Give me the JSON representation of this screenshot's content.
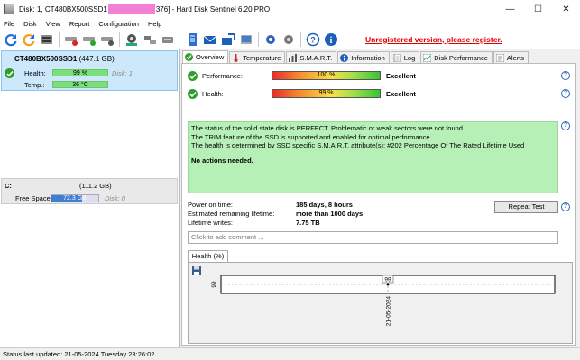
{
  "window": {
    "title_prefix": "Disk: 1, CT480BX500SSD1",
    "title_suffix": "376]  -  Hard Disk Sentinel 6.20 PRO",
    "minimize": "—",
    "maximize": "☐",
    "close": "✕"
  },
  "menu": {
    "file": "File",
    "disk": "Disk",
    "view": "View",
    "report": "Report",
    "configuration": "Configuration",
    "help": "Help"
  },
  "toolbar": {
    "unregistered": "Unregistered version, please register."
  },
  "disk": {
    "name": "CT480BX500SSD1",
    "size": "(447.1 GB)",
    "health_label": "Health:",
    "health_value": "99 %",
    "health_fraction": 0.99,
    "temp_label": "Temp.:",
    "temp_value": "36 °C",
    "disk_index": "Disk: 1"
  },
  "volume": {
    "letter": "C:",
    "size": "(111.2 GB)",
    "free_label": "Free Space",
    "free_value": "72.3 GB",
    "free_fraction": 0.65,
    "disk_index": "Disk: 0"
  },
  "tabs": [
    {
      "label": "Overview"
    },
    {
      "label": "Temperature"
    },
    {
      "label": "S.M.A.R.T."
    },
    {
      "label": "Information"
    },
    {
      "label": "Log"
    },
    {
      "label": "Disk Performance"
    },
    {
      "label": "Alerts"
    }
  ],
  "overview": {
    "performance_label": "Performance:",
    "performance_value": "100 %",
    "performance_word": "Excellent",
    "health_label": "Health:",
    "health_value": "99 %",
    "health_word": "Excellent",
    "summary_lines": [
      "The status of the solid state disk is PERFECT. Problematic or weak sectors were not found.",
      "The TRIM feature of the SSD is supported and enabled for optimal performance.",
      "The health is determined by SSD specific S.M.A.R.T. attribute(s):  #202 Percentage Of The Rated Lifetime Used"
    ],
    "summary_action": "No actions needed.",
    "power_on_label": "Power on time:",
    "power_on_value": "185 days, 8 hours",
    "remaining_label": "Estimated remaining lifetime:",
    "remaining_value": "more than 1000 days",
    "writes_label": "Lifetime writes:",
    "writes_value": "7.75 TB",
    "repeat_test": "Repeat Test",
    "comment_placeholder": "Click to add comment ...",
    "health_tab": "Health (%)"
  },
  "chart_data": {
    "type": "line",
    "title": "",
    "xlabel": "",
    "ylabel": "",
    "x": [
      "21-05-2024"
    ],
    "y_tick_labels": [
      "99"
    ],
    "series": [
      {
        "values": [
          99
        ]
      }
    ],
    "data_labels": [
      "99"
    ]
  },
  "status": {
    "text": "Status last updated: 21-05-2024 Tuesday 23:26:02"
  },
  "colors": {
    "selection_bg": "#cde8fb",
    "summary_bg": "#b7f0b7",
    "ok_green": "#2e9e2e",
    "link_red": "#e00000",
    "volume_bar": "#3f7fd0"
  }
}
